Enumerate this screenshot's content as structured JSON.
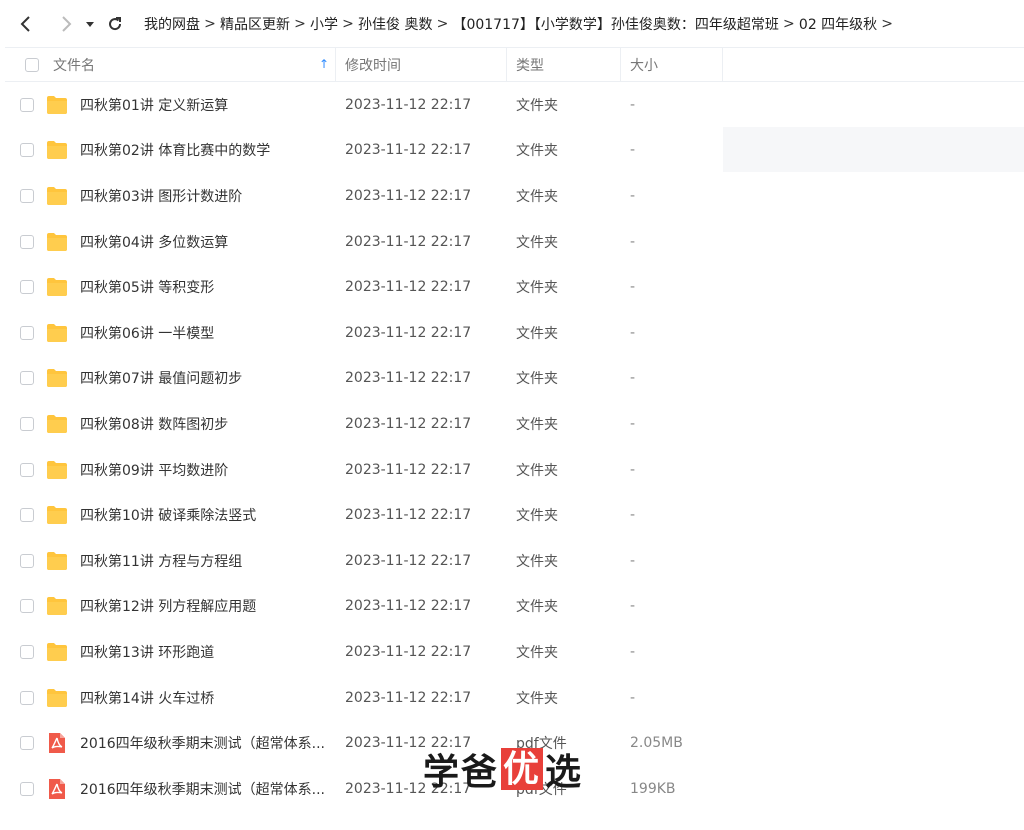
{
  "breadcrumb": [
    "我的网盘",
    "精品区更新",
    "小学",
    "孙佳俊 奥数",
    "【001717】【小学数学】孙佳俊奥数：四年级超常班",
    "02 四年级秋"
  ],
  "columns": {
    "name": "文件名",
    "modified": "修改时间",
    "type": "类型",
    "size": "大小"
  },
  "files": [
    {
      "name": "四秋第01讲 定义新运算",
      "modified": "2023-11-12 22:17",
      "type": "文件夹",
      "size": "-",
      "icon": "folder-icon"
    },
    {
      "name": "四秋第02讲 体育比赛中的数学",
      "modified": "2023-11-12 22:17",
      "type": "文件夹",
      "size": "-",
      "icon": "folder-icon"
    },
    {
      "name": "四秋第03讲 图形计数进阶",
      "modified": "2023-11-12 22:17",
      "type": "文件夹",
      "size": "-",
      "icon": "folder-icon"
    },
    {
      "name": "四秋第04讲 多位数运算",
      "modified": "2023-11-12 22:17",
      "type": "文件夹",
      "size": "-",
      "icon": "folder-icon"
    },
    {
      "name": "四秋第05讲 等积变形",
      "modified": "2023-11-12 22:17",
      "type": "文件夹",
      "size": "-",
      "icon": "folder-icon"
    },
    {
      "name": "四秋第06讲 一半模型",
      "modified": "2023-11-12 22:17",
      "type": "文件夹",
      "size": "-",
      "icon": "folder-icon"
    },
    {
      "name": "四秋第07讲 最值问题初步",
      "modified": "2023-11-12 22:17",
      "type": "文件夹",
      "size": "-",
      "icon": "folder-icon"
    },
    {
      "name": "四秋第08讲 数阵图初步",
      "modified": "2023-11-12 22:17",
      "type": "文件夹",
      "size": "-",
      "icon": "folder-icon"
    },
    {
      "name": "四秋第09讲 平均数进阶",
      "modified": "2023-11-12 22:17",
      "type": "文件夹",
      "size": "-",
      "icon": "folder-icon"
    },
    {
      "name": "四秋第10讲 破译乘除法竖式",
      "modified": "2023-11-12 22:17",
      "type": "文件夹",
      "size": "-",
      "icon": "folder-icon"
    },
    {
      "name": "四秋第11讲 方程与方程组",
      "modified": "2023-11-12 22:17",
      "type": "文件夹",
      "size": "-",
      "icon": "folder-icon"
    },
    {
      "name": "四秋第12讲 列方程解应用题",
      "modified": "2023-11-12 22:17",
      "type": "文件夹",
      "size": "-",
      "icon": "folder-icon"
    },
    {
      "name": "四秋第13讲 环形跑道",
      "modified": "2023-11-12 22:17",
      "type": "文件夹",
      "size": "-",
      "icon": "folder-icon"
    },
    {
      "name": "四秋第14讲 火车过桥",
      "modified": "2023-11-12 22:17",
      "type": "文件夹",
      "size": "-",
      "icon": "folder-icon"
    },
    {
      "name": "2016四年级秋季期末测试（超常体系...",
      "modified": "2023-11-12 22:17",
      "type": "pdf文件",
      "size": "2.05MB",
      "icon": "pdf-icon"
    },
    {
      "name": "2016四年级秋季期末测试（超常体系...",
      "modified": "2023-11-12 22:17",
      "type": "pdf文件",
      "size": "199KB",
      "icon": "pdf-icon"
    }
  ],
  "watermark": {
    "part1": "学爸",
    "highlight": "优",
    "part2": "选"
  },
  "colors": {
    "accent": "#2f8cff",
    "folder": "#ffc53d",
    "pdf": "#f05a4a",
    "watermark_bg": "#e8403a"
  }
}
